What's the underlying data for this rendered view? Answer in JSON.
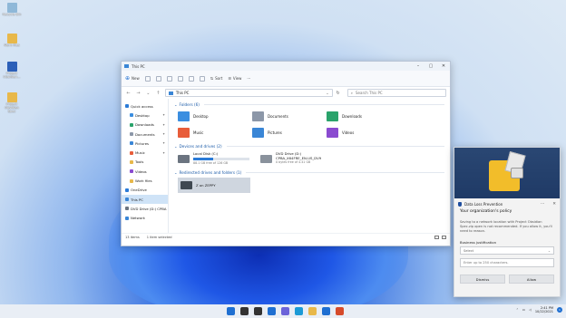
{
  "desktop_icons": [
    {
      "label": "Recycle Bin",
      "color": "#8fb8d8"
    },
    {
      "label": "Work files",
      "color": "#e8b84a"
    },
    {
      "label": "Project Obsidian...",
      "color": "#2b5fb8"
    },
    {
      "label": "Project Obsidian Spec",
      "color": "#e8b84a"
    }
  ],
  "explorer": {
    "title": "This PC",
    "toolbar": {
      "new_label": "New",
      "sort_label": "Sort",
      "view_label": "View",
      "more_label": "···"
    },
    "address": "This PC",
    "search_placeholder": "Search This PC",
    "nav_items": [
      {
        "label": "Quick access",
        "color": "#2b7bd7",
        "pin": ""
      },
      {
        "label": "Desktop",
        "color": "#3b8ee0",
        "pin": "✦"
      },
      {
        "label": "Downloads",
        "color": "#2aa36b",
        "pin": "✦"
      },
      {
        "label": "Documents",
        "color": "#8c97a8",
        "pin": "✦"
      },
      {
        "label": "Pictures",
        "color": "#3a86d6",
        "pin": "✦"
      },
      {
        "label": "Music",
        "color": "#e85d3a",
        "pin": "✦"
      },
      {
        "label": "Tools",
        "color": "#e8b84a",
        "pin": ""
      },
      {
        "label": "Videos",
        "color": "#8a4bd0",
        "pin": ""
      },
      {
        "label": "Work files",
        "color": "#e8b84a",
        "pin": ""
      },
      {
        "label": "OneDrive",
        "color": "#2b7bd7",
        "pin": ""
      },
      {
        "label": "This PC",
        "color": "#3a86d6",
        "pin": ""
      },
      {
        "label": "DVD Drive (D:) CPBA",
        "color": "#6b7480",
        "pin": ""
      },
      {
        "label": "Network",
        "color": "#3a86d6",
        "pin": ""
      }
    ],
    "groups": {
      "folders": "Folders (6)",
      "devices": "Devices and drives (2)",
      "redirected": "Redirected drives and folders (1)"
    },
    "folders": [
      {
        "name": "Desktop",
        "color": "#3b8ee0"
      },
      {
        "name": "Documents",
        "color": "#8c97a8"
      },
      {
        "name": "Downloads",
        "color": "#2aa36b"
      },
      {
        "name": "Music",
        "color": "#e85d3a"
      },
      {
        "name": "Pictures",
        "color": "#3a86d6"
      },
      {
        "name": "Videos",
        "color": "#8a4bd0"
      }
    ],
    "drives": [
      {
        "name": "Local Disk (C:)",
        "sub": "88.1 GB free of 126 GB",
        "has_bar": true
      },
      {
        "name": "DVD Drive (D:)",
        "name2": "CPBA_X64FRE_EN-US_DV9",
        "sub": "0 bytes free of 4.41 GB",
        "has_bar": false
      }
    ],
    "network_drive": {
      "name": "Z on ZEPPY"
    },
    "status": {
      "items": "13 items",
      "selected": "1 item selected"
    }
  },
  "dlp": {
    "title": "Data Loss Prevention",
    "heading": "Your organization's policy",
    "message": "Saving to a network location with Project Obsidian Spec.zip open is not recommended. If you allow it, you'll need to reason.",
    "justification_label": "Business justification",
    "select_placeholder": "Select",
    "textarea_placeholder": "Enter up to 250 characters.",
    "dismiss_label": "Dismiss",
    "allow_label": "Allow"
  },
  "taskbar": {
    "time": "2:41 PM",
    "date": "10/22/2021",
    "notif_count": "1",
    "icons": [
      {
        "name": "start-icon",
        "color": "#1f6fd1"
      },
      {
        "name": "search-icon",
        "color": "#333333"
      },
      {
        "name": "task-view-icon",
        "color": "#333333"
      },
      {
        "name": "widgets-icon",
        "color": "#1f6fd1"
      },
      {
        "name": "chat-icon",
        "color": "#6b63d9"
      },
      {
        "name": "edge-icon",
        "color": "#1b9ad6"
      },
      {
        "name": "file-explorer-icon",
        "color": "#e8b84a"
      },
      {
        "name": "store-icon",
        "color": "#1f6fd1"
      },
      {
        "name": "office-icon",
        "color": "#d64b2b"
      }
    ]
  }
}
